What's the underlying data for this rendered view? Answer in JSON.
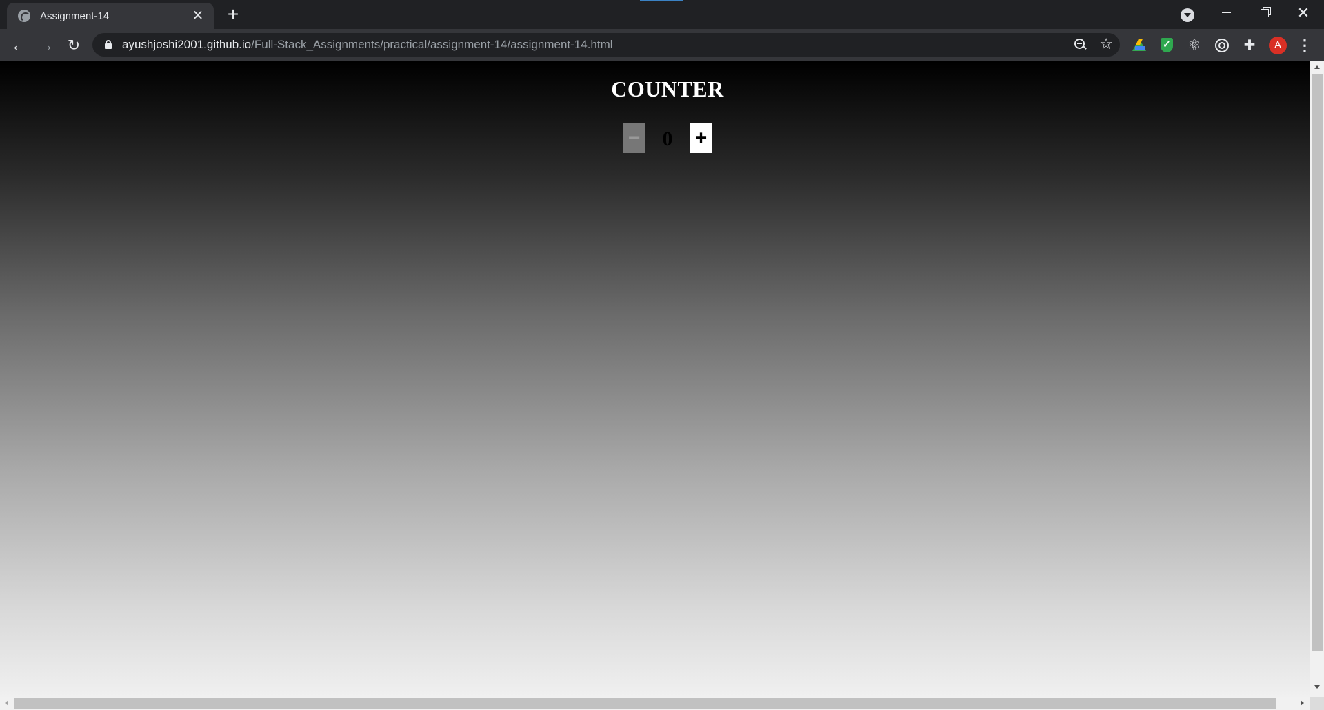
{
  "browser": {
    "tab": {
      "title": "Assignment-14",
      "close_glyph": "✕",
      "favicon": "globe-icon"
    },
    "new_tab_glyph": "+",
    "toolbar": {
      "back_glyph": "←",
      "forward_glyph": "→",
      "reload_glyph": "↻",
      "url_host": "ayushjoshi2001.github.io",
      "url_path": "/Full-Stack_Assignments/practical/assignment-14/assignment-14.html",
      "star_glyph": "☆"
    },
    "extensions": [
      "google-drive-icon",
      "shield-check-icon",
      "atom-icon",
      "target-icon",
      "puzzle-icon"
    ],
    "atom_glyph": "⚛",
    "puzzle_glyph": "✚",
    "avatar_letter": "A",
    "menu_glyph": "⋮",
    "window_close_glyph": "✕"
  },
  "page": {
    "title": "COUNTER",
    "decrement_label": "−",
    "increment_label": "+",
    "count": "0"
  },
  "colors": {
    "gradient_top": "#000000",
    "gradient_bottom": "#f0f0f0",
    "decrement_bg": "#777777",
    "increment_bg": "#ffffff",
    "avatar_bg": "#d93025"
  }
}
